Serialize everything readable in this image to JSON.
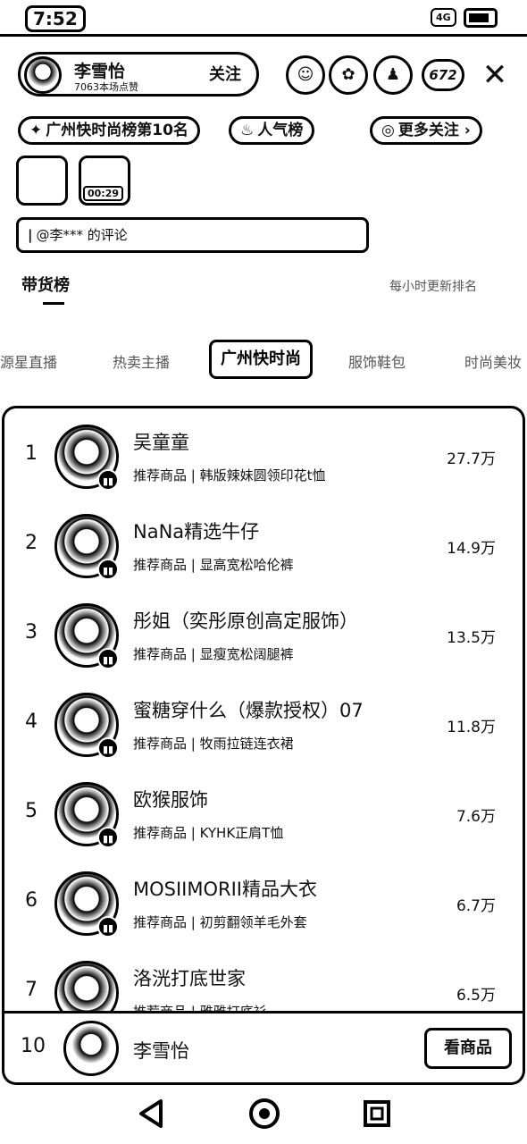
{
  "status": {
    "time": "7:52",
    "signal": "4G"
  },
  "live": {
    "host_name": "李雪怡",
    "host_sub": "7063本场点赞",
    "follow_label": "关注",
    "viewer_count": "672",
    "close_glyph": "✕",
    "chips": [
      {
        "icon": "fire-icon",
        "label": "广州快时尚榜第10名"
      },
      {
        "icon": "flame-icon",
        "label": "人气榜"
      },
      {
        "icon": "search-icon",
        "label": "更多关注"
      }
    ],
    "thumb_time": "00:29",
    "comment": "@李*** 的评论"
  },
  "panel": {
    "title": "带货榜",
    "side_text": "每小时更新排名"
  },
  "tabs": [
    "源星直播",
    "热卖主播",
    "广州快时尚",
    "服饰鞋包",
    "时尚美妆"
  ],
  "active_tab": "广州快时尚",
  "ranking": [
    {
      "rank": "1",
      "name": "吴童童",
      "sub": "推荐商品 | 韩版辣妹圆领印花t恤",
      "value": "27.7万"
    },
    {
      "rank": "2",
      "name": "NaNa精选牛仔",
      "sub": "推荐商品 | 显高宽松哈伦裤",
      "value": "14.9万"
    },
    {
      "rank": "3",
      "name": "彤姐（奕彤原创高定服饰）",
      "sub": "推荐商品 | 显瘦宽松阔腿裤",
      "value": "13.5万"
    },
    {
      "rank": "4",
      "name": "蜜糖穿什么（爆款授权）07",
      "sub": "推荐商品 | 牧雨拉链连衣裙",
      "value": "11.8万"
    },
    {
      "rank": "5",
      "name": "欧猴服饰",
      "sub": "推荐商品 | KYHK正肩T恤",
      "value": "7.6万"
    },
    {
      "rank": "6",
      "name": "MOSIIMORII精品大衣",
      "sub": "推荐商品 | 初剪翻领羊毛外套",
      "value": "6.7万"
    },
    {
      "rank": "7",
      "name": "洛洸打底世家",
      "sub": "推荐商品 | 雅雅打底衫",
      "value": "6.5万"
    }
  ],
  "me": {
    "rank": "10",
    "name": "李雪怡",
    "button": "看商品"
  },
  "colors": {
    "ink": "#000000",
    "paper": "#ffffff",
    "muted": "#555555"
  }
}
